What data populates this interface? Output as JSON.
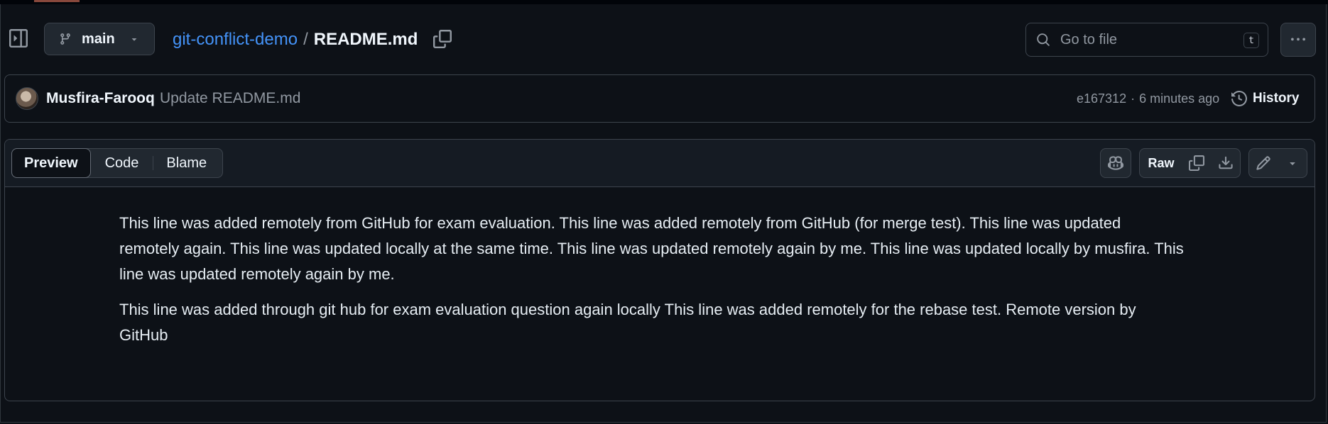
{
  "header": {
    "branch": "main",
    "repo_name": "git-conflict-demo",
    "separator": "/",
    "file_name": "README.md",
    "search_placeholder": "Go to file",
    "search_shortcut": "t"
  },
  "commit": {
    "author": "Musfira-Farooq",
    "message": "Update README.md",
    "sha": "e167312",
    "dot": "·",
    "time": "6 minutes ago",
    "history_label": "History"
  },
  "file_view": {
    "tabs": [
      {
        "label": "Preview",
        "active": true
      },
      {
        "label": "Code",
        "active": false
      },
      {
        "label": "Blame",
        "active": false
      }
    ],
    "raw_label": "Raw"
  },
  "readme": {
    "paragraphs": [
      "This line was added remotely from GitHub for exam evaluation. This line was added remotely from GitHub (for merge test). This line was updated remotely again. This line was updated locally at the same time. This line was updated remotely again by me. This line was updated locally by musfira. This line was updated remotely again by me.",
      "This line was added through git hub for exam evaluation question again locally This line was added remotely for the rebase test. Remote version by GitHub"
    ]
  },
  "colors": {
    "background": "#0d1117",
    "link": "#4493f8",
    "border": "#3d444d",
    "muted": "#9198a1"
  }
}
